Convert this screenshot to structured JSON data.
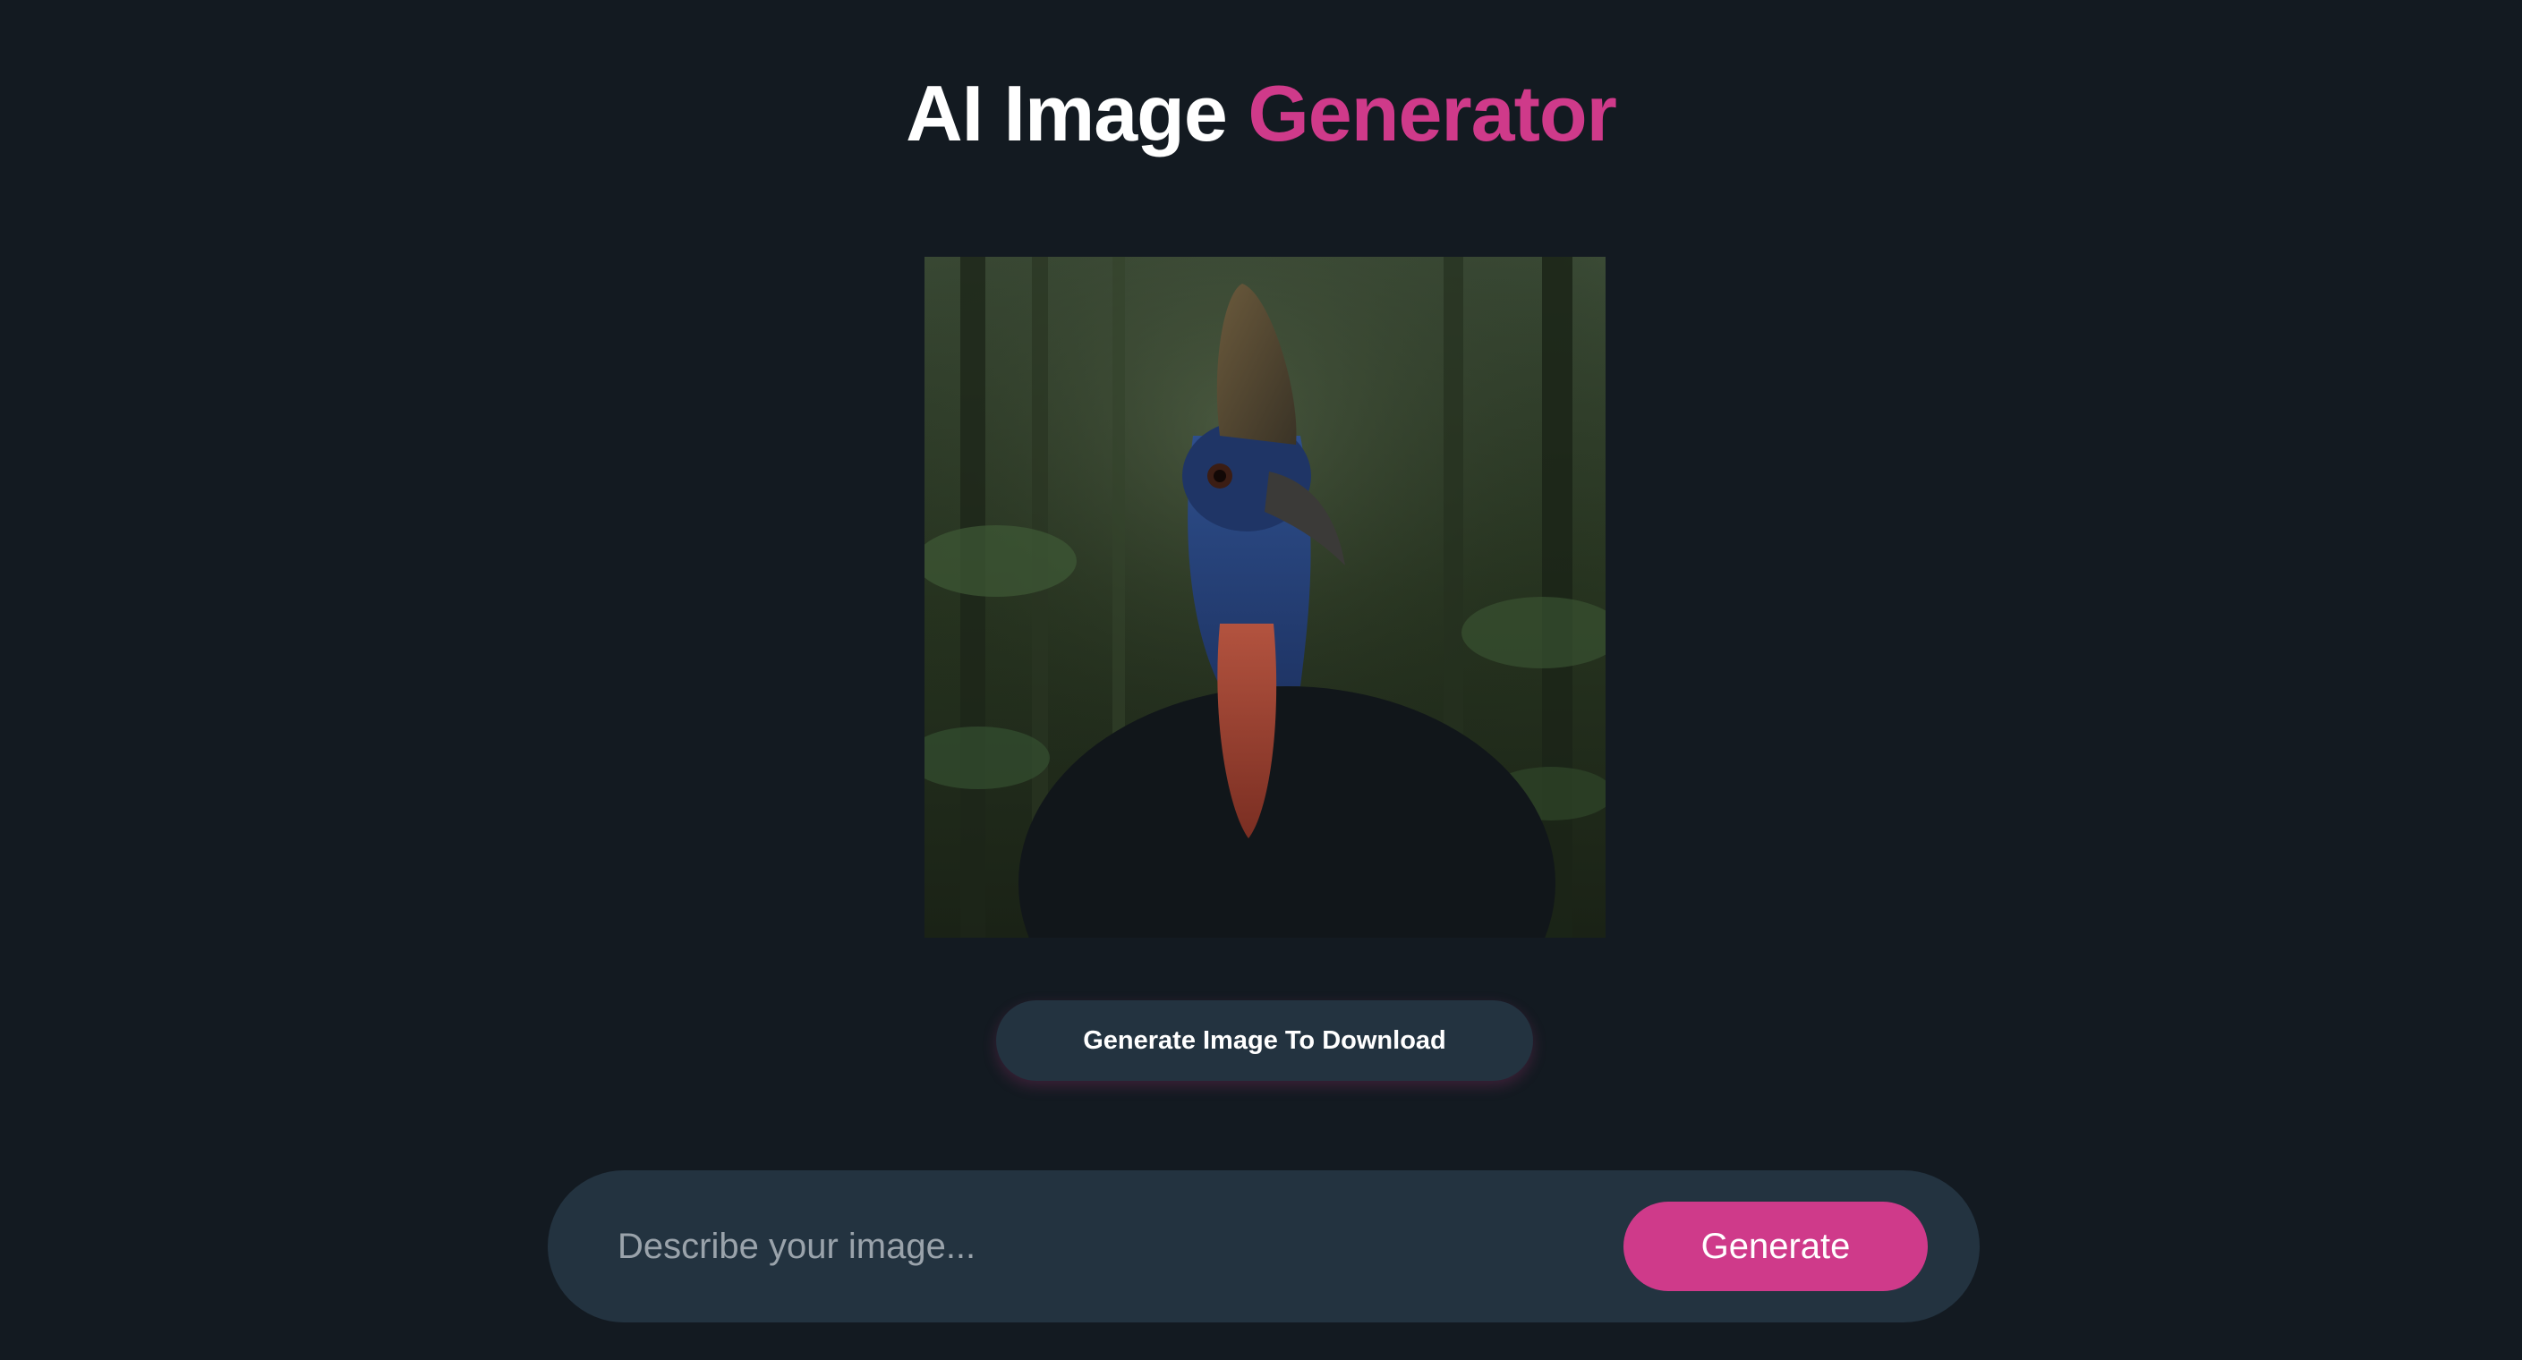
{
  "header": {
    "title_part1": "AI Image",
    "title_part2": "Generator"
  },
  "image": {
    "subject_icon": "cassowary-image"
  },
  "actions": {
    "download_label": "Generate Image To Download"
  },
  "prompt": {
    "placeholder": "Describe your image...",
    "value": "",
    "generate_label": "Generate"
  },
  "colors": {
    "background": "#131a21",
    "panel": "#233340",
    "accent": "#cf3a8a",
    "text": "#ffffff",
    "placeholder": "#9aa3ab"
  }
}
